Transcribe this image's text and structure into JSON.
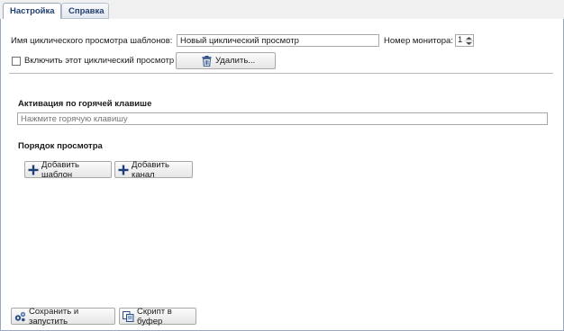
{
  "tabs": [
    {
      "label": "Настройка",
      "active": true
    },
    {
      "label": "Справка",
      "active": false
    }
  ],
  "form": {
    "name_label": "Имя циклического просмотра шаблонов:",
    "name_value": "Новый циклический просмотр",
    "monitor_label": "Номер монитора:",
    "monitor_value": "1",
    "enable_label": "Включить этот циклический просмотр",
    "enable_checked": false,
    "delete_label": "Удалить..."
  },
  "hotkey": {
    "title": "Активация по горячей клавише",
    "placeholder": "Нажмите горячую клавишу"
  },
  "order": {
    "title": "Порядок просмотра",
    "add_template_label": "Добавить шаблон",
    "add_channel_label": "Добавить канал"
  },
  "footer": {
    "save_run_label": "Сохранить и запустить",
    "script_label": "Скрипт в буфер"
  },
  "icons": {
    "delete": "trash-icon",
    "add_template": "plus-icon",
    "add_channel": "plus-icon",
    "save_run": "gears-icon",
    "script": "copy-icon"
  },
  "colors": {
    "tab_text": "#1f3f73",
    "accent_plus": "#1e3f78",
    "border": "#9aa9bd"
  }
}
